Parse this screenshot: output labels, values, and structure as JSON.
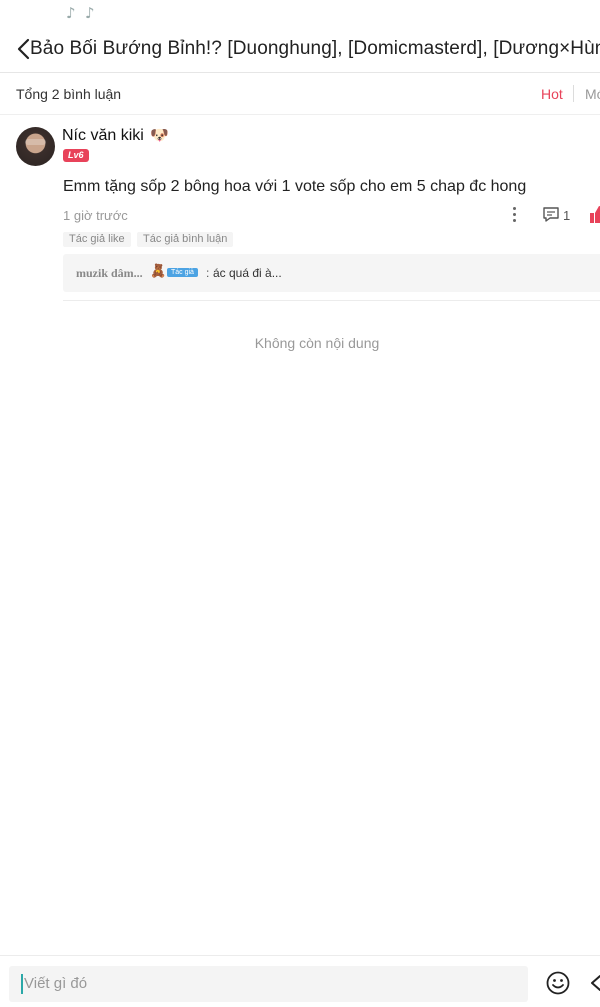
{
  "status_bar": {
    "icons": [
      "tiktok-icon",
      "tiktok-icon"
    ]
  },
  "header": {
    "back_icon": "chevron-left-icon",
    "title": "Bảo Bối Bướng Bỉnh!? [Duonghung], [Domicmasterd], [Dương×Hùng]"
  },
  "comments_bar": {
    "count_label": "Tổng 2 bình luận",
    "sort_hot": "Hot",
    "sort_other": "Mới"
  },
  "comment": {
    "username": "Níc văn kiki",
    "username_emoji": "🐶",
    "level_badge": "Lv6",
    "text": "Emm tặng sốp 2 bông hoa với 1 vote sốp cho em 5 chap đc hong",
    "time": "1 giờ trước",
    "reply_count": "1",
    "tags": [
      "Tác giả like",
      "Tác giả bình luận"
    ],
    "reply": {
      "username": "muzik dâm...",
      "emoji": "🧸",
      "badge": "Tác giả",
      "separator": ":",
      "text": "ác quá đi à..."
    }
  },
  "empty_state": "Không còn nội dung",
  "composer": {
    "placeholder": "Viết gì đó"
  },
  "colors": {
    "accent": "#e8435a",
    "badge_blue": "#4ca3e3"
  }
}
